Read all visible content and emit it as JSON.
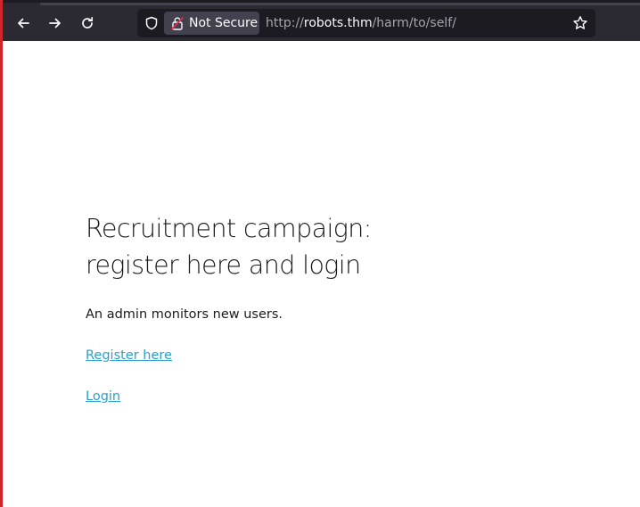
{
  "browser": {
    "security_label": "Not Secure",
    "url_scheme": "http://",
    "url_host": "robots.thm",
    "url_path": "/harm/to/self/",
    "icons": {
      "back": "back-arrow-icon",
      "forward": "forward-arrow-icon",
      "reload": "reload-icon",
      "shield": "tracking-shield-icon",
      "lock": "insecure-lock-icon",
      "bookmark": "bookmark-star-icon"
    }
  },
  "page": {
    "heading_line1": "Recruitment campaign:",
    "heading_line2": "register here and login",
    "intro": "An admin monitors new users.",
    "register_link": "Register here",
    "login_link": "Login"
  },
  "colors": {
    "toolbar": "#2b2a33",
    "urlbar": "#1c1b22",
    "link": "#2aa0c8",
    "insecure_accent": "#e22850",
    "window_edge": "#d1252c"
  }
}
